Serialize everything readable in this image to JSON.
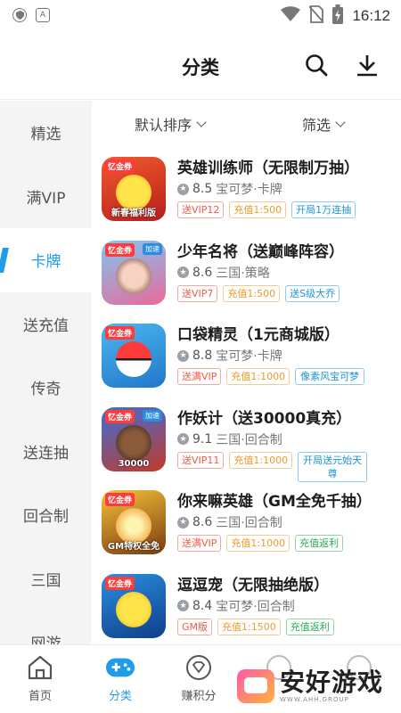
{
  "status_bar": {
    "left_icons": [
      "shield-icon",
      "a-badge-icon"
    ],
    "a_badge_text": "A",
    "right_icons": [
      "wifi-icon",
      "no-sim-icon",
      "battery-charging-icon"
    ],
    "time": "16:12"
  },
  "header": {
    "title": "分类",
    "icons": [
      "search-icon",
      "download-icon"
    ]
  },
  "sidebar": {
    "items": [
      {
        "label": "精选",
        "active": false
      },
      {
        "label": "满VIP",
        "active": false
      },
      {
        "label": "卡牌",
        "active": true
      },
      {
        "label": "送充值",
        "active": false
      },
      {
        "label": "传奇",
        "active": false
      },
      {
        "label": "送连抽",
        "active": false
      },
      {
        "label": "回合制",
        "active": false
      },
      {
        "label": "三国",
        "active": false
      },
      {
        "label": "网游",
        "active": false
      }
    ],
    "active_color": "#1f9dea"
  },
  "filters": {
    "sort_label": "默认排序",
    "filter_label": "筛选"
  },
  "games": [
    {
      "name": "英雄训练师（无限制万抽）",
      "score": "8.5",
      "category": "宝可梦·卡牌",
      "icon_tag": "忆金券",
      "icon_badge": "",
      "icon_bottom": "新春福利版",
      "tags": [
        {
          "text": "送VIP12",
          "color": "red"
        },
        {
          "text": "充值1:500",
          "color": "orange"
        },
        {
          "text": "开局1万连抽",
          "color": "blue"
        }
      ]
    },
    {
      "name": "少年名将（送巅峰阵容）",
      "score": "8.6",
      "category": "三国·策略",
      "icon_tag": "忆金券",
      "icon_badge": "加速",
      "icon_bottom": "",
      "tags": [
        {
          "text": "送VIP7",
          "color": "red"
        },
        {
          "text": "充值1:500",
          "color": "orange"
        },
        {
          "text": "送S级大乔",
          "color": "blue"
        }
      ]
    },
    {
      "name": "口袋精灵（1元商城版）",
      "score": "8.8",
      "category": "宝可梦·卡牌",
      "icon_tag": "忆金券",
      "icon_badge": "",
      "icon_bottom": "",
      "tags": [
        {
          "text": "送满VIP",
          "color": "red"
        },
        {
          "text": "充值1:1000",
          "color": "orange"
        },
        {
          "text": "像素风宝可梦",
          "color": "blue"
        }
      ]
    },
    {
      "name": "作妖计（送30000真充）",
      "score": "9.1",
      "category": "三国·回合制",
      "icon_tag": "忆金券",
      "icon_badge": "加速",
      "icon_bottom": "30000",
      "tags": [
        {
          "text": "送VIP11",
          "color": "red"
        },
        {
          "text": "充值1:1000",
          "color": "orange"
        },
        {
          "text": "开局送元始天尊",
          "color": "blue"
        }
      ]
    },
    {
      "name": "你来嘛英雄（GM全免千抽）",
      "score": "8.6",
      "category": "三国·回合制",
      "icon_tag": "忆金券",
      "icon_badge": "",
      "icon_bottom": "GM特权全免",
      "tags": [
        {
          "text": "送满VIP",
          "color": "red"
        },
        {
          "text": "充值1:1000",
          "color": "orange"
        },
        {
          "text": "充值返利",
          "color": "green"
        }
      ]
    },
    {
      "name": "逗逗宠（无限抽绝版）",
      "score": "8.4",
      "category": "宝可梦·回合制",
      "icon_tag": "忆金券",
      "icon_badge": "",
      "icon_bottom": "",
      "tags": [
        {
          "text": "GM版",
          "color": "red"
        },
        {
          "text": "充值1:1500",
          "color": "orange"
        },
        {
          "text": "充值返利",
          "color": "green"
        }
      ]
    }
  ],
  "bottom_nav": {
    "items": [
      {
        "label": "首页",
        "icon": "home-icon",
        "active": false
      },
      {
        "label": "分类",
        "icon": "gamepad-icon",
        "active": true
      },
      {
        "label": "赚积分",
        "icon": "diamond-icon",
        "active": false
      },
      {
        "label": "",
        "icon": "tab-icon",
        "active": false
      },
      {
        "label": "",
        "icon": "tab-icon",
        "active": false
      }
    ]
  },
  "watermark": {
    "title": "安好游戏",
    "subtitle": "WWW.AHH.GROUP"
  },
  "colors": {
    "accent": "#1f9dea",
    "tag_red": "#f25a4a",
    "tag_orange": "#ee9a2a",
    "tag_blue": "#1b95d8",
    "tag_green": "#2eaa55"
  }
}
